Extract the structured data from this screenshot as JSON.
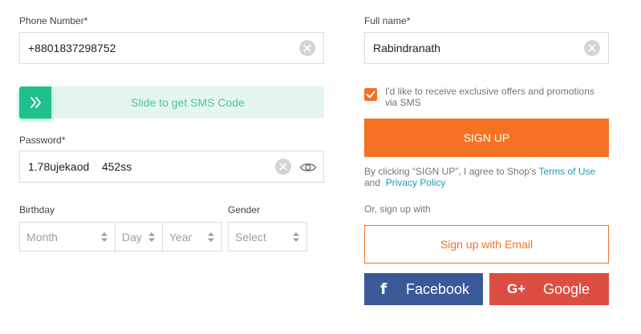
{
  "left": {
    "phone": {
      "label": "Phone Number*",
      "value": "+8801837298752"
    },
    "sms_slider": {
      "label": "Slide to get SMS Code",
      "handle_icon": "double-chevron-right-icon"
    },
    "password": {
      "label": "Password*",
      "value": "1.78ujekaod    452ss"
    },
    "birthday": {
      "label": "Birthday",
      "month": "Month",
      "day": "Day",
      "year": "Year"
    },
    "gender": {
      "label": "Gender",
      "value": "Select"
    }
  },
  "right": {
    "fullname": {
      "label": "Full name*",
      "value": "Rabindranath"
    },
    "consent": {
      "checked": true,
      "text_line1": "I'd like to receive exclusive offers and promotions",
      "text_line2": "via SMS"
    },
    "signup_button": "SIGN UP",
    "terms": {
      "prefix": "By clicking “SIGN UP”, I agree to Shop's",
      "terms_link": "Terms of Use",
      "and": "and",
      "privacy_link": "Privacy Policy"
    },
    "or_text": "Or, sign up with",
    "email_button": "Sign up with Email",
    "facebook_button": "Facebook",
    "google_button": "Google"
  },
  "colors": {
    "accent": "#f57224",
    "slider_bg": "#e4f6ee",
    "slider_handle": "#1ec08e",
    "slider_text": "#4fc49b",
    "link": "#1a9cb7",
    "facebook": "#3b5998",
    "google": "#dc4e41"
  }
}
